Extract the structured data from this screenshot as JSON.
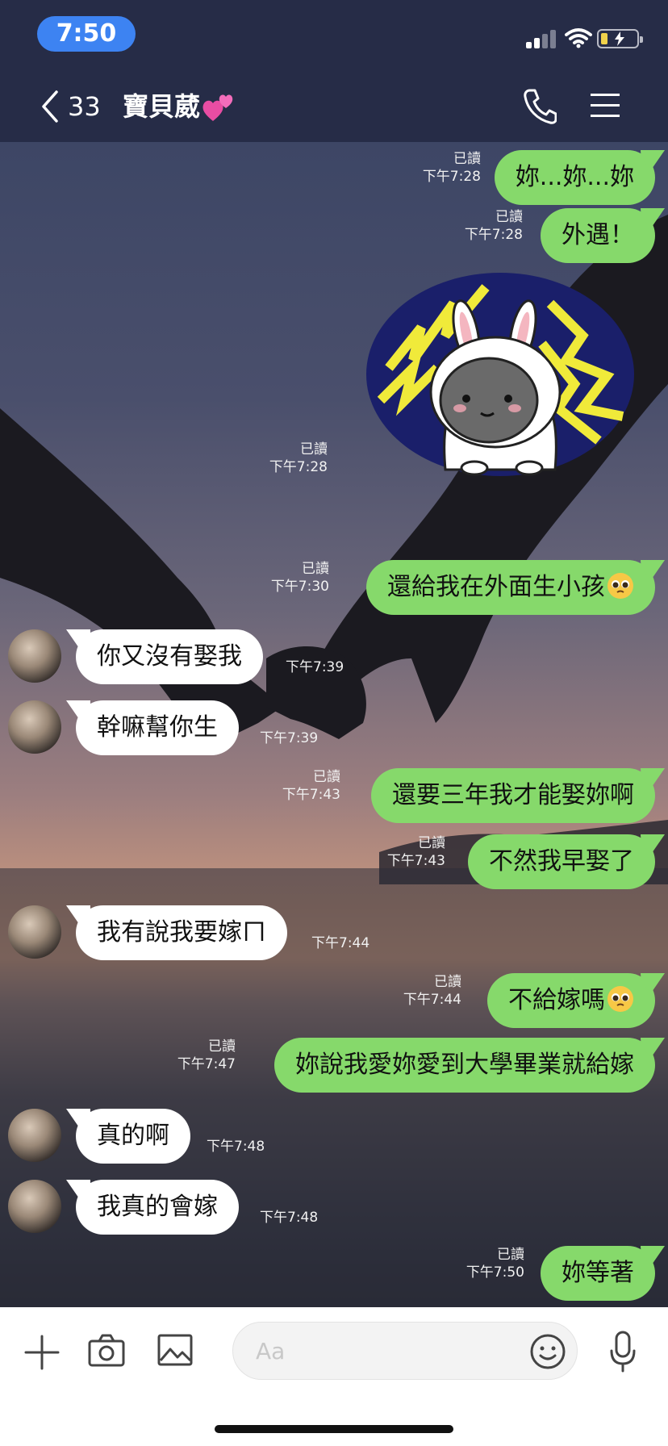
{
  "status_bar": {
    "time": "7:50"
  },
  "header": {
    "unread_count": "33",
    "title": "寶貝葳"
  },
  "messages": [
    {
      "side": "out",
      "text": "妳...妳...妳",
      "read": "已讀",
      "time": "下午7:28"
    },
    {
      "side": "out",
      "text": "外遇！",
      "read": "已讀",
      "time": "下午7:28"
    },
    {
      "side": "out",
      "type": "sticker",
      "sticker": "brown-cony-bunny-lightning-sticker",
      "read": "已讀",
      "time": "下午7:28"
    },
    {
      "side": "out",
      "text": "還給我在外面生小孩",
      "emoji": "pleading-face",
      "read": "已讀",
      "time": "下午7:30"
    },
    {
      "side": "in",
      "text": "你又沒有娶我",
      "time": "下午7:39"
    },
    {
      "side": "in",
      "text": "幹嘛幫你生",
      "time": "下午7:39"
    },
    {
      "side": "out",
      "text": "還要三年我才能娶妳啊",
      "read": "已讀",
      "time": "下午7:43"
    },
    {
      "side": "out",
      "text": "不然我早娶了",
      "read": "已讀",
      "time": "下午7:43"
    },
    {
      "side": "in",
      "text": "我有說我要嫁ㄇ",
      "time": "下午7:44"
    },
    {
      "side": "out",
      "text": "不給嫁嗎",
      "emoji": "pleading-face",
      "read": "已讀",
      "time": "下午7:44"
    },
    {
      "side": "out",
      "text": "妳說我愛妳愛到大學畢業就給嫁",
      "read": "已讀",
      "time": "下午7:47"
    },
    {
      "side": "in",
      "text": "真的啊",
      "time": "下午7:48"
    },
    {
      "side": "in",
      "text": "我真的會嫁",
      "time": "下午7:48"
    },
    {
      "side": "out",
      "text": "妳等著",
      "read": "已讀",
      "time": "下午7:50"
    }
  ],
  "input": {
    "placeholder": "Aa",
    "value": ""
  },
  "colors": {
    "header_bg": "#262c47",
    "out_bubble": "#86d96b",
    "in_bubble": "#ffffff",
    "time_pill": "#3d83f2"
  }
}
